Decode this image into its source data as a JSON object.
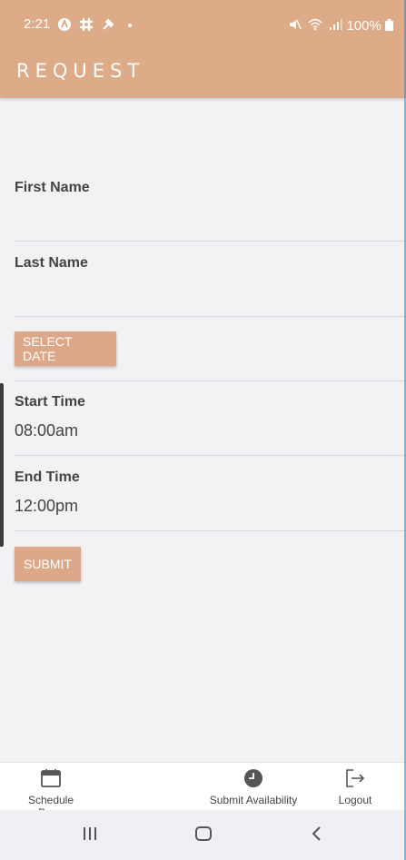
{
  "status": {
    "time": "2:21",
    "battery": "100%"
  },
  "header": {
    "title": "REQUEST"
  },
  "form": {
    "first_name_label": "First Name",
    "last_name_label": "Last Name",
    "select_date_label": "SELECT DATE",
    "start_time_label": "Start Time",
    "start_time_value": "08:00am",
    "end_time_label": "End Time",
    "end_time_value": "12:00pm",
    "submit_label": "SUBMIT"
  },
  "bottom_nav": {
    "items": [
      {
        "label": "Schedule Page",
        "icon": "calendar-icon"
      },
      {
        "label": "Submit Availability",
        "icon": "clock-icon"
      },
      {
        "label": "Logout",
        "icon": "logout-icon"
      }
    ]
  },
  "colors": {
    "accent": "#ddab88",
    "background": "#f2f1f4"
  }
}
